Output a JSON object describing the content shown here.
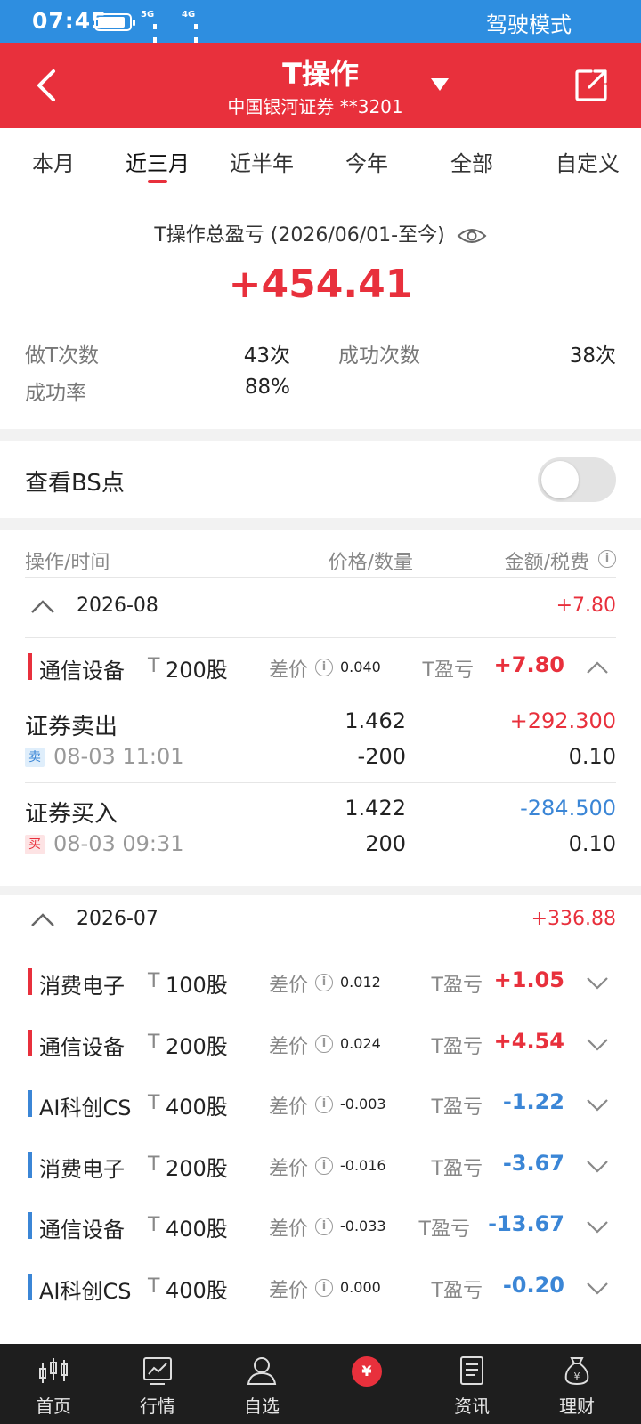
{
  "status_bar": {
    "time": "07:45",
    "net1": "5G",
    "net2": "4G",
    "mode": "驾驶模式"
  },
  "header": {
    "title": "T操作",
    "subtitle": "中国银河证券 **3201"
  },
  "tabs": [
    {
      "label": "本月"
    },
    {
      "label": "近三月",
      "active": true
    },
    {
      "label": "近半年"
    },
    {
      "label": "今年"
    },
    {
      "label": "全部"
    },
    {
      "label": "自定义"
    }
  ],
  "summary": {
    "title": "T操作总盈亏 (2026/06/01-至今)",
    "total": "+454.41",
    "metrics": [
      {
        "label": "做T次数",
        "value": "43次"
      },
      {
        "label": "成功次数",
        "value": "38次"
      },
      {
        "label": "成功率",
        "value": "88%"
      }
    ]
  },
  "bs_toggle": {
    "label": "查看BS点",
    "on": false
  },
  "columns": {
    "op_time": "操作/时间",
    "price_qty": "价格/数量",
    "amount_fee": "金额/税费"
  },
  "groups": [
    {
      "month": "2026-08",
      "total": "+7.80",
      "items": [
        {
          "name": "通信设备",
          "t": "T",
          "qty": "200股",
          "diff_label": "差价",
          "diff": "0.040",
          "pnl_label": "T盈亏",
          "pnl": "+7.80",
          "expanded": true,
          "ops": [
            {
              "name": "证券卖出",
              "badge": "卖",
              "time": "08-03 11:01",
              "price": "1.462",
              "qty": "-200",
              "amount": "+292.300",
              "fee": "0.10"
            },
            {
              "name": "证券买入",
              "badge": "买",
              "time": "08-03 09:31",
              "price": "1.422",
              "qty": "200",
              "amount": "-284.500",
              "fee": "0.10"
            }
          ]
        }
      ]
    },
    {
      "month": "2026-07",
      "total": "+336.88",
      "items": [
        {
          "name": "消费电子",
          "t": "T",
          "qty": "100股",
          "diff_label": "差价",
          "diff": "0.012",
          "pnl_label": "T盈亏",
          "pnl": "+1.05"
        },
        {
          "name": "通信设备",
          "t": "T",
          "qty": "200股",
          "diff_label": "差价",
          "diff": "0.024",
          "pnl_label": "T盈亏",
          "pnl": "+4.54"
        },
        {
          "name": "AI科创CS",
          "t": "T",
          "qty": "400股",
          "diff_label": "差价",
          "diff": "-0.003",
          "pnl_label": "T盈亏",
          "pnl": "-1.22"
        },
        {
          "name": "消费电子",
          "t": "T",
          "qty": "200股",
          "diff_label": "差价",
          "diff": "-0.016",
          "pnl_label": "T盈亏",
          "pnl": "-3.67"
        },
        {
          "name": "通信设备",
          "t": "T",
          "qty": "400股",
          "diff_label": "差价",
          "diff": "-0.033",
          "pnl_label": "T盈亏",
          "pnl": "-13.67"
        },
        {
          "name": "AI科创CS",
          "t": "T",
          "qty": "400股",
          "diff_label": "差价",
          "diff": "0.000",
          "pnl_label": "T盈亏",
          "pnl": "-0.20"
        }
      ]
    }
  ],
  "bottom_nav": [
    {
      "label": "首页",
      "icon": "candlestick-icon"
    },
    {
      "label": "行情",
      "icon": "chart-icon"
    },
    {
      "label": "自选",
      "icon": "user-icon"
    },
    {
      "label": "",
      "icon": "yen-icon",
      "active": true,
      "glyph": "¥"
    },
    {
      "label": "资讯",
      "icon": "document-icon"
    },
    {
      "label": "理财",
      "icon": "money-bag-icon"
    }
  ],
  "colors": {
    "brand_red": "#e8303c",
    "status_blue": "#2e8ee0",
    "loss_blue": "#3b86d6"
  }
}
